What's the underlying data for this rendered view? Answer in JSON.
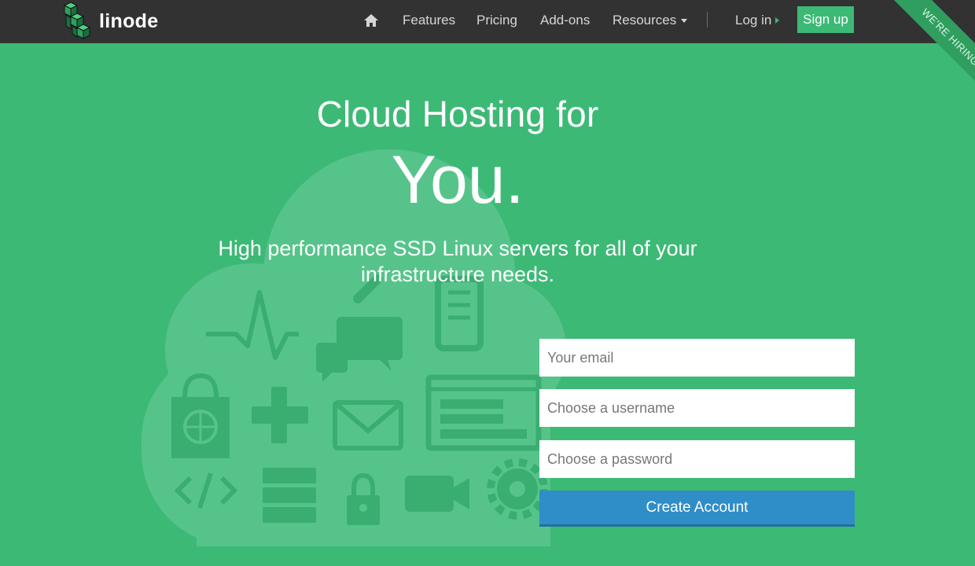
{
  "brand": {
    "name": "linode"
  },
  "nav": {
    "home_icon": "home-icon",
    "features": "Features",
    "pricing": "Pricing",
    "addons": "Add-ons",
    "resources": "Resources",
    "login": "Log in",
    "signup": "Sign up"
  },
  "ribbon": {
    "text": "WE'RE HIRING!"
  },
  "hero": {
    "title_line1": "Cloud Hosting for",
    "title_line2": "You.",
    "subtitle": "High performance SSD Linux servers for all of your infrastructure needs."
  },
  "form": {
    "email_placeholder": "Your email",
    "username_placeholder": "Choose a username",
    "password_placeholder": "Choose a password",
    "submit_label": "Create Account"
  },
  "colors": {
    "background": "#3db976",
    "navbar": "#323232",
    "button": "#2f8dc8",
    "cloud": "#56c48a",
    "icon": "#3aad70"
  },
  "illustration_icons": [
    "pulse-icon",
    "magnifier-icon",
    "chat-icon",
    "mobile-icon",
    "shopping-bag-icon",
    "dpad-icon",
    "envelope-icon",
    "browser-icon",
    "code-icon",
    "server-icon",
    "lock-icon",
    "video-camera-icon",
    "gear-icon"
  ]
}
